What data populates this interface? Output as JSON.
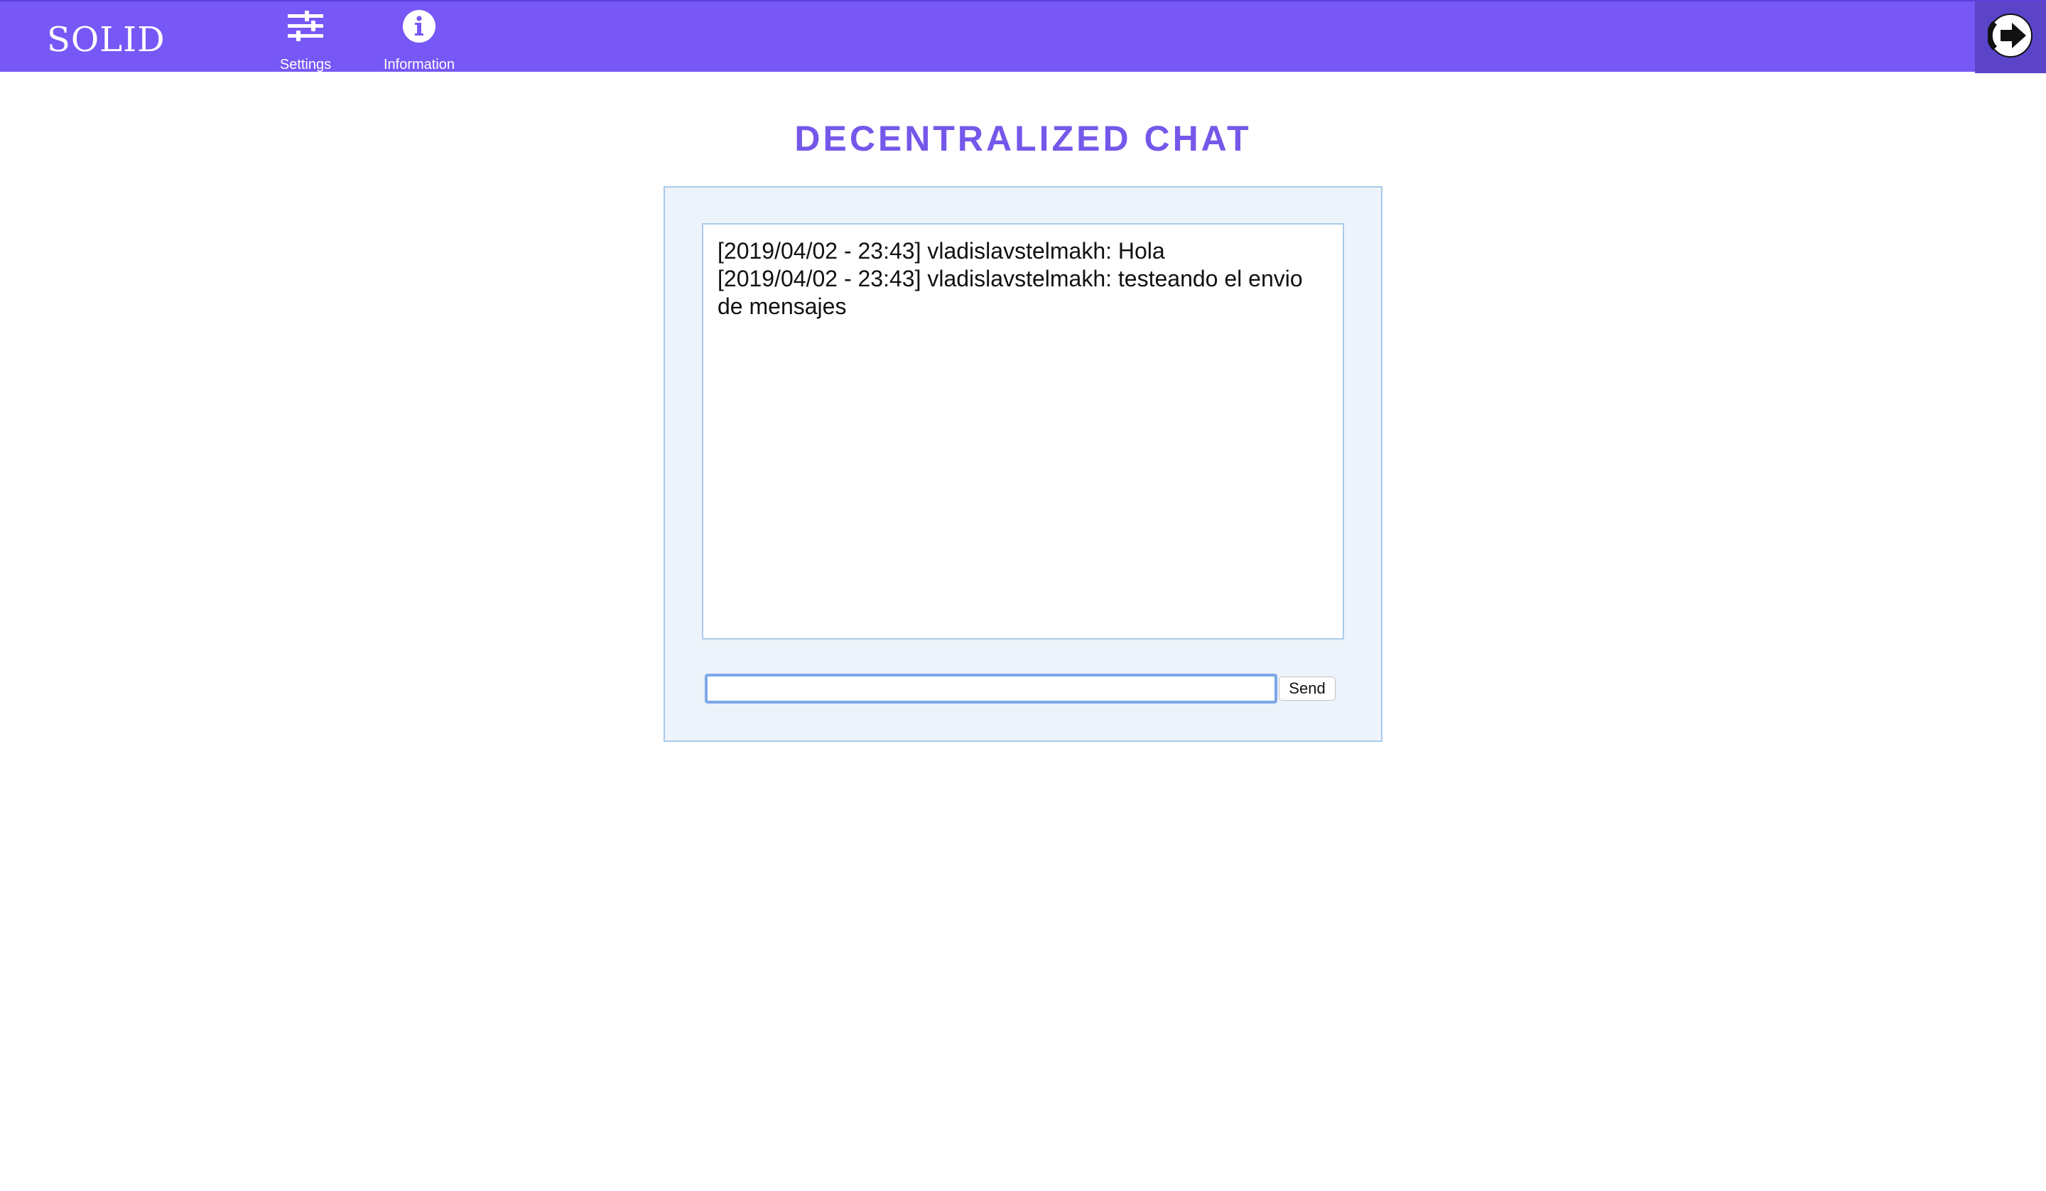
{
  "header": {
    "brand": "SOLID",
    "nav": [
      {
        "label": "Settings",
        "icon": "sliders-icon"
      },
      {
        "label": "Information",
        "icon": "info-icon"
      }
    ],
    "logout_icon": "logout-icon",
    "bar_color": "#7758f6"
  },
  "main": {
    "title": "DECENTRALIZED CHAT",
    "messages": [
      "[2019/04/02 - 23:43] vladislavstelmakh: Hola",
      "[2019/04/02 - 23:43] vladislavstelmakh: testeando el envio de mensajes"
    ],
    "input": {
      "value": "",
      "placeholder": ""
    },
    "send_label": "Send"
  }
}
